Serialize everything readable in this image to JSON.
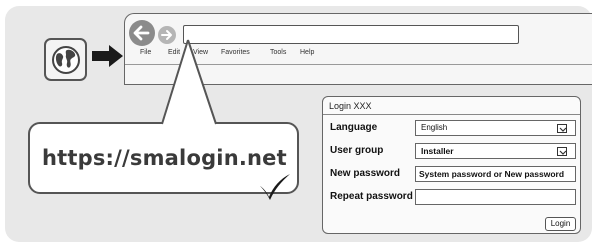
{
  "browser": {
    "menu": [
      "File",
      "Edit",
      "View",
      "Favorites",
      "Tools",
      "Help"
    ]
  },
  "callout": {
    "url": "https://smalogin.net"
  },
  "login": {
    "title": "Login XXX",
    "fields": [
      {
        "label": "Language",
        "value": "English"
      },
      {
        "label": "User group",
        "value": "Installer"
      },
      {
        "label": "New password",
        "value": "System password or New password"
      },
      {
        "label": "Repeat password",
        "value": ""
      }
    ],
    "button_label": "Login"
  },
  "icons": {
    "globe": "globe-icon",
    "arrow": "arrow-right-icon",
    "back": "back-arrow-icon",
    "forward": "forward-arrow-icon",
    "dropdown": "dropdown-chevron-icon",
    "check": "checkmark-icon"
  }
}
